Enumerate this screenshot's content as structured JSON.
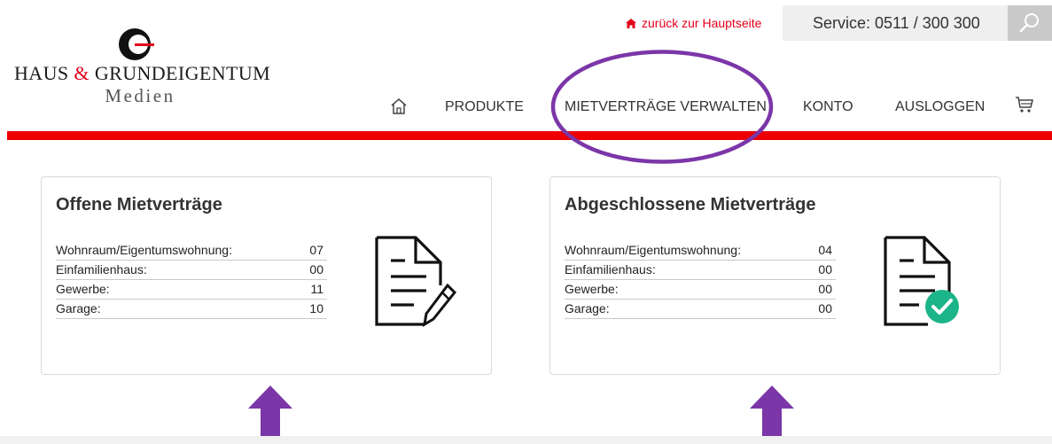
{
  "header": {
    "logo_line1_a": "HAUS",
    "logo_line1_amp": "&",
    "logo_line1_b": "GRUNDEIGENTUM",
    "logo_line2": "Medien",
    "back_link": "zurück zur Hauptseite",
    "service": "Service: 0511 / 300 300"
  },
  "nav": {
    "items": [
      {
        "label": "PRODUKTE"
      },
      {
        "label": "MIETVERTRÄGE VERWALTEN"
      },
      {
        "label": "KONTO"
      },
      {
        "label": "AUSLOGGEN"
      }
    ]
  },
  "cards": [
    {
      "title": "Offene Mietverträge",
      "rows": [
        {
          "label": "Wohnraum/Eigentumswohnung:",
          "value": "07"
        },
        {
          "label": "Einfamilienhaus:",
          "value": "00"
        },
        {
          "label": "Gewerbe:",
          "value": "11"
        },
        {
          "label": "Garage:",
          "value": "10"
        }
      ],
      "icon": "document-edit-icon"
    },
    {
      "title": "Abgeschlossene Mietverträge",
      "rows": [
        {
          "label": "Wohnraum/Eigentumswohnung:",
          "value": "04"
        },
        {
          "label": "Einfamilienhaus:",
          "value": "00"
        },
        {
          "label": "Gewerbe:",
          "value": "00"
        },
        {
          "label": "Garage:",
          "value": "00"
        }
      ],
      "icon": "document-check-icon"
    }
  ],
  "colors": {
    "brand_red": "#ee0000",
    "annotation_purple": "#7b36a8",
    "check_green": "#1cb489"
  }
}
